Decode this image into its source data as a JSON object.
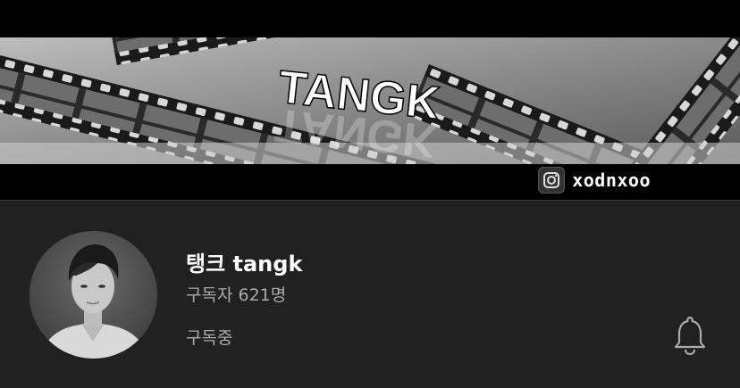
{
  "banner": {
    "title": "TANGK",
    "instagram_handle": "xodnxoo",
    "instagram_icon": "instagram-icon"
  },
  "channel": {
    "name": "탱크 tangk",
    "subscriber_count": "구독자 621명",
    "subscribe_status": "구독중",
    "avatar": "avatar-photo",
    "bell_icon": "bell-icon"
  },
  "colors": {
    "background": "#212121",
    "banner_bg": "#000000",
    "primary_text": "#ffffff",
    "secondary_text": "#aaaaaa"
  }
}
